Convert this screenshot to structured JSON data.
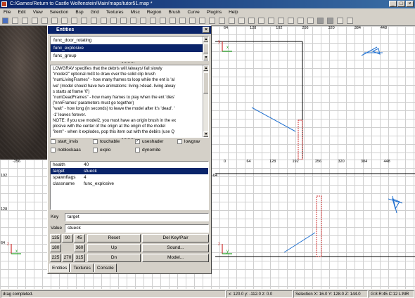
{
  "window": {
    "title": "C:/Games/Return to Castle Wolfenstein/Main/maps/tutor51.map *",
    "min": "_",
    "max": "□",
    "close": "×"
  },
  "menu": [
    "File",
    "Edit",
    "View",
    "Selection",
    "Bsp",
    "Grid",
    "Textures",
    "Misc",
    "Region",
    "Brush",
    "Curve",
    "Plugins",
    "Help"
  ],
  "views": {
    "top_right": {
      "top_ticks": [
        "64",
        "128",
        "192",
        "256",
        "320",
        "384",
        "448"
      ],
      "left_ticks": [],
      "axis_x": "x",
      "axis_y": "y"
    },
    "bottom_left": {
      "top_ticks": [
        "-256"
      ],
      "left_ticks": [
        "192",
        "128",
        "64"
      ],
      "axis_x": "x",
      "axis_y": "z"
    },
    "bottom_right": {
      "top_ticks": [
        "0",
        "64",
        "128",
        "192",
        "256",
        "320",
        "384",
        "448"
      ],
      "left_ticks": [
        "-64"
      ],
      "axis_x": "y",
      "axis_y": "z"
    }
  },
  "entities": {
    "title": "Entities",
    "list": [
      "func_door_rotating",
      "func_explosive",
      "func_group"
    ],
    "selected_index": 1,
    "description": [
      "LOWGRAV specifies that the debris will /always/ fall slowly",
      "\"model2\" optional md3 to draw over the solid clip brush",
      "\"numLivingFrames\" - how many frames to loop while the ent is 'al",
      "ive' (model should have two animations: living->dead. living alway",
      "s starts at frame '0')",
      "\"numDeadFrames\" - how many frames to play when the ent 'dies'",
      " ('nnnFrames' parameters must go together)",
      "\"wait\" - how long (in seconds) to leave the model after it's 'dead'. '",
      "-1' leaves forever.",
      "NOTE: if you use model2, you must have an origin brush in the ex",
      "plosive with the center of the origin at the origin of the model",
      "\"item\" - when it explodes, pop this item out with the debirs (use Q"
    ],
    "flags": [
      {
        "label": "start_invis",
        "checked": false
      },
      {
        "label": "touchable",
        "checked": false
      },
      {
        "label": "useshader",
        "checked": true
      },
      {
        "label": "lowgrav",
        "checked": false
      },
      {
        "label": "noblockaas",
        "checked": false
      },
      {
        "label": "explo",
        "checked": false
      },
      {
        "label": "dynomite",
        "checked": false
      }
    ],
    "keyvalues": [
      {
        "key": "health",
        "value": "40"
      },
      {
        "key": "target",
        "value": "stueck"
      },
      {
        "key": "spawnflags",
        "value": "4"
      },
      {
        "key": "classname",
        "value": "func_explosive"
      }
    ],
    "kv_selected": 1,
    "key_label": "Key",
    "key_value": "target",
    "value_label": "Value",
    "value_value": "stueck",
    "angle_buttons": [
      "135",
      "90",
      "45",
      "180",
      "",
      "360",
      "225",
      "270",
      "315"
    ],
    "buttons": {
      "reset": "Reset",
      "up": "Up",
      "dn": "Dn",
      "del": "Del Key/Pair",
      "sound": "Sound...",
      "model": "Model..."
    },
    "tabs": [
      "Entities",
      "Textures",
      "Console"
    ],
    "active_tab": 0
  },
  "status": {
    "message": "drag completed.",
    "coords": "x: 120.0  y: -112.0  z: 0.0",
    "selection": "Selection X: 16.0  Y: 128.0  Z: 144.0",
    "grid": "G:8 R:45 C:12 L:MR"
  },
  "colors": {
    "title": "#0a246a",
    "selection": "#0a246a",
    "brush": "#d03030",
    "entity_line": "#2070d0"
  }
}
